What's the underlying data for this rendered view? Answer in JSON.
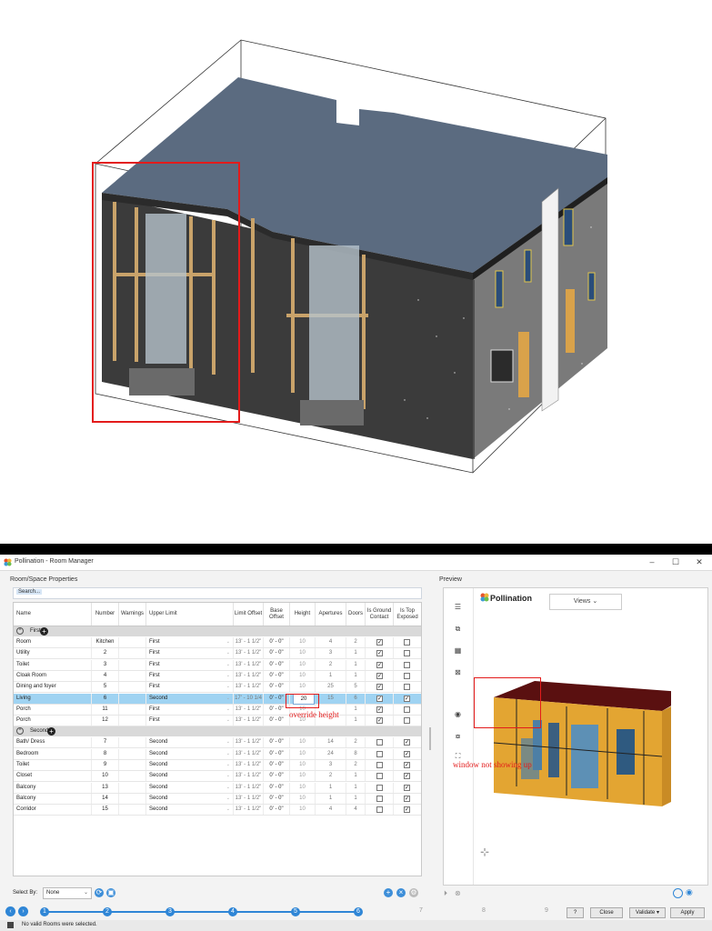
{
  "window": {
    "title": "Pollination - Room Manager",
    "controls": [
      "–",
      "☐",
      "✕"
    ]
  },
  "annotations": {
    "override_height": "override height",
    "window_not_showing": "window not showing up"
  },
  "left_panel": {
    "header": "Room/Space Properties",
    "search_placeholder": "Search...",
    "columns": [
      "Name",
      "Number",
      "Warnings",
      "Upper Limit",
      "Limit Offset",
      "Base Offset",
      "Height",
      "Apertures",
      "Doors",
      "Is Ground Contact",
      "Is Top Exposed"
    ],
    "groups": [
      {
        "label": "First",
        "rows": [
          {
            "name": "Room",
            "number": "Kitchen",
            "upper": "First",
            "limit": "13' - 1 1/2\"",
            "base": "0' - 0\"",
            "height": "10",
            "apertures": "4",
            "doors": "2",
            "ground": true,
            "top": false
          },
          {
            "name": "Utility",
            "number": "2",
            "upper": "First",
            "limit": "13' - 1 1/2\"",
            "base": "0' - 0\"",
            "height": "10",
            "apertures": "3",
            "doors": "1",
            "ground": true,
            "top": false
          },
          {
            "name": "Toilet",
            "number": "3",
            "upper": "First",
            "limit": "13' - 1 1/2\"",
            "base": "0' - 0\"",
            "height": "10",
            "apertures": "2",
            "doors": "1",
            "ground": true,
            "top": false
          },
          {
            "name": "Cloak Room",
            "number": "4",
            "upper": "First",
            "limit": "13' - 1 1/2\"",
            "base": "0' - 0\"",
            "height": "10",
            "apertures": "1",
            "doors": "1",
            "ground": true,
            "top": false
          },
          {
            "name": "Dining and foyer",
            "number": "5",
            "upper": "First",
            "limit": "13' - 1 1/2\"",
            "base": "0' - 0\"",
            "height": "10",
            "apertures": "25",
            "doors": "5",
            "ground": true,
            "top": false
          },
          {
            "name": "Living",
            "number": "6",
            "upper": "Second",
            "limit": "17' - 10 1/4",
            "base": "0' - 0\"",
            "height": "20",
            "apertures": "15",
            "doors": "6",
            "ground": true,
            "top": true,
            "selected": true
          },
          {
            "name": "Porch",
            "number": "11",
            "upper": "First",
            "limit": "13' - 1 1/2\"",
            "base": "0' - 0\"",
            "height": "10",
            "apertures": "",
            "doors": "1",
            "ground": true,
            "top": false
          },
          {
            "name": "Porch",
            "number": "12",
            "upper": "First",
            "limit": "13' - 1 1/2\"",
            "base": "0' - 0\"",
            "height": "10",
            "apertures": "",
            "doors": "1",
            "ground": true,
            "top": false
          }
        ]
      },
      {
        "label": "Second",
        "rows": [
          {
            "name": "Bath/ Dress",
            "number": "7",
            "upper": "Second",
            "limit": "13' - 1 1/2\"",
            "base": "0' - 0\"",
            "height": "10",
            "apertures": "14",
            "doors": "2",
            "ground": false,
            "top": true
          },
          {
            "name": "Bedroom",
            "number": "8",
            "upper": "Second",
            "limit": "13' - 1 1/2\"",
            "base": "0' - 0\"",
            "height": "10",
            "apertures": "24",
            "doors": "8",
            "ground": false,
            "top": true
          },
          {
            "name": "Toilet",
            "number": "9",
            "upper": "Second",
            "limit": "13' - 1 1/2\"",
            "base": "0' - 0\"",
            "height": "10",
            "apertures": "3",
            "doors": "2",
            "ground": false,
            "top": true
          },
          {
            "name": "Closet",
            "number": "10",
            "upper": "Second",
            "limit": "13' - 1 1/2\"",
            "base": "0' - 0\"",
            "height": "10",
            "apertures": "2",
            "doors": "1",
            "ground": false,
            "top": true
          },
          {
            "name": "Balcony",
            "number": "13",
            "upper": "Second",
            "limit": "13' - 1 1/2\"",
            "base": "0' - 0\"",
            "height": "10",
            "apertures": "1",
            "doors": "1",
            "ground": false,
            "top": true
          },
          {
            "name": "Balcony",
            "number": "14",
            "upper": "Second",
            "limit": "13' - 1 1/2\"",
            "base": "0' - 0\"",
            "height": "10",
            "apertures": "1",
            "doors": "1",
            "ground": false,
            "top": true
          },
          {
            "name": "Corridor",
            "number": "15",
            "upper": "Second",
            "limit": "13' - 1 1/2\"",
            "base": "0' - 0\"",
            "height": "10",
            "apertures": "4",
            "doors": "4",
            "ground": false,
            "top": true
          }
        ]
      }
    ],
    "select_by_label": "Select By:",
    "select_by_value": "None"
  },
  "preview": {
    "header": "Preview",
    "brand": "Pollination",
    "views_label": "Views"
  },
  "steps": {
    "active": [
      "1",
      "2",
      "3",
      "4",
      "5",
      "6"
    ],
    "inactive": [
      "7",
      "8",
      "9"
    ]
  },
  "buttons": {
    "help": "?",
    "close": "Close",
    "validate": "Validate",
    "apply": "Apply"
  },
  "status": "No valid Rooms were selected."
}
